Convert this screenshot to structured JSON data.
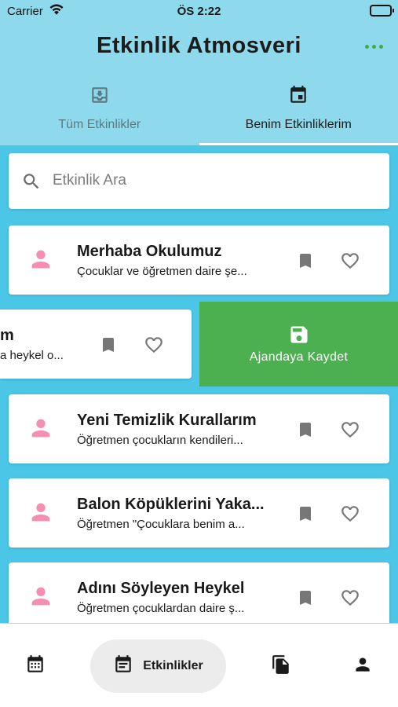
{
  "status_bar": {
    "carrier": "Carrier",
    "time": "ÖS 2:22"
  },
  "header": {
    "title": "Etkinlik Atmosveri"
  },
  "tabs": [
    {
      "label": "Tüm Etkinlikler",
      "icon": "inbox-icon",
      "active": false
    },
    {
      "label": "Benim Etkinliklerim",
      "icon": "calendar-event-icon",
      "active": true
    }
  ],
  "search": {
    "placeholder": "Etkinlik Ara",
    "value": ""
  },
  "events": [
    {
      "title": "Merhaba Okulumuz",
      "subtitle": "Çocuklar ve öğretmen daire şe..."
    },
    {
      "title": "Yeni Temizlik Kurallarım",
      "subtitle": "Öğretmen çocukların kendileri..."
    },
    {
      "title": "Balon Köpüklerini Yaka...",
      "subtitle": "Öğretmen \"Çocuklara benim a..."
    },
    {
      "title": "Adını Söyleyen Heykel",
      "subtitle": "Öğretmen çocuklardan daire ş..."
    }
  ],
  "swiped_event": {
    "title": "m",
    "subtitle": "a heykel o..."
  },
  "swipe_action": {
    "label": "Ajandaya Kaydet",
    "color": "#4caf50"
  },
  "bottom_nav": {
    "items": [
      {
        "icon": "calendar-grid-icon",
        "label": ""
      },
      {
        "icon": "event-note-icon",
        "label": "Etkinlikler",
        "active": true
      },
      {
        "icon": "documents-icon",
        "label": ""
      },
      {
        "icon": "person-icon",
        "label": ""
      }
    ]
  },
  "colors": {
    "header": "#8ed9ec",
    "background": "#4cc6e6",
    "avatar": "#f48fb1",
    "accent": "#3cb043"
  }
}
